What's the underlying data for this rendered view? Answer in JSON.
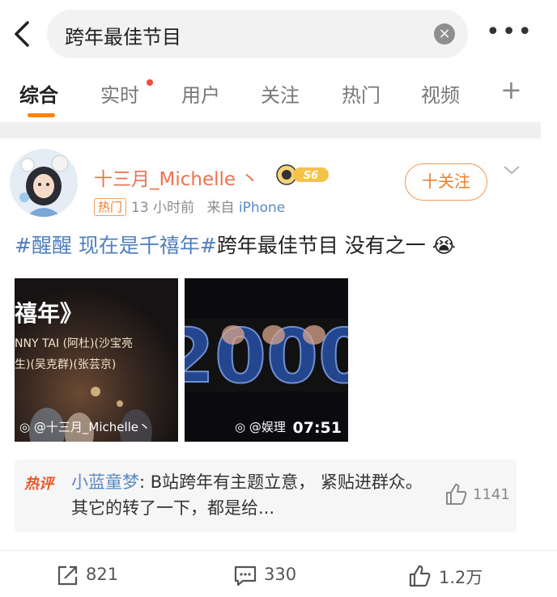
{
  "search": {
    "query": "跨年最佳节目"
  },
  "tabs": [
    {
      "label": "综合"
    },
    {
      "label": "实时"
    },
    {
      "label": "用户"
    },
    {
      "label": "关注"
    },
    {
      "label": "热门"
    },
    {
      "label": "视频"
    }
  ],
  "post": {
    "username": "十三月_Michelle",
    "verify_mark": "丶",
    "badge_level": "S6",
    "follow_label": "十关注",
    "hot_tag": "热门",
    "time": "13 小时前",
    "source_prefix": "来自",
    "source": "iPhone",
    "text": {
      "topic1": "#醒醒 现在是千禧年#",
      "rest": "跨年最佳节目 没有之一",
      "emoji": "😭"
    },
    "media": [
      {
        "watermark": "@十三月_Michelle丶",
        "overlay_title": "禧年》",
        "credits_line1": "NNY TAI (阿杜)(沙宝亮",
        "credits_line2": "生)(吴克群)(张芸京)"
      },
      {
        "watermark": "@娱理",
        "duration": "07:51",
        "big_text": "2000"
      }
    ]
  },
  "hot_comment": {
    "label": "热评",
    "user": "小蓝童梦",
    "text": "B站跨年有主题立意， 紧贴进群众。其它的转了一下，都是给...",
    "likes": "1141"
  },
  "actions": {
    "repost": "821",
    "comment": "330",
    "like": "1.2万"
  },
  "colors": {
    "accent_orange": "#ff8200",
    "username": "#eb7350",
    "link_blue": "#4f7fbe"
  }
}
